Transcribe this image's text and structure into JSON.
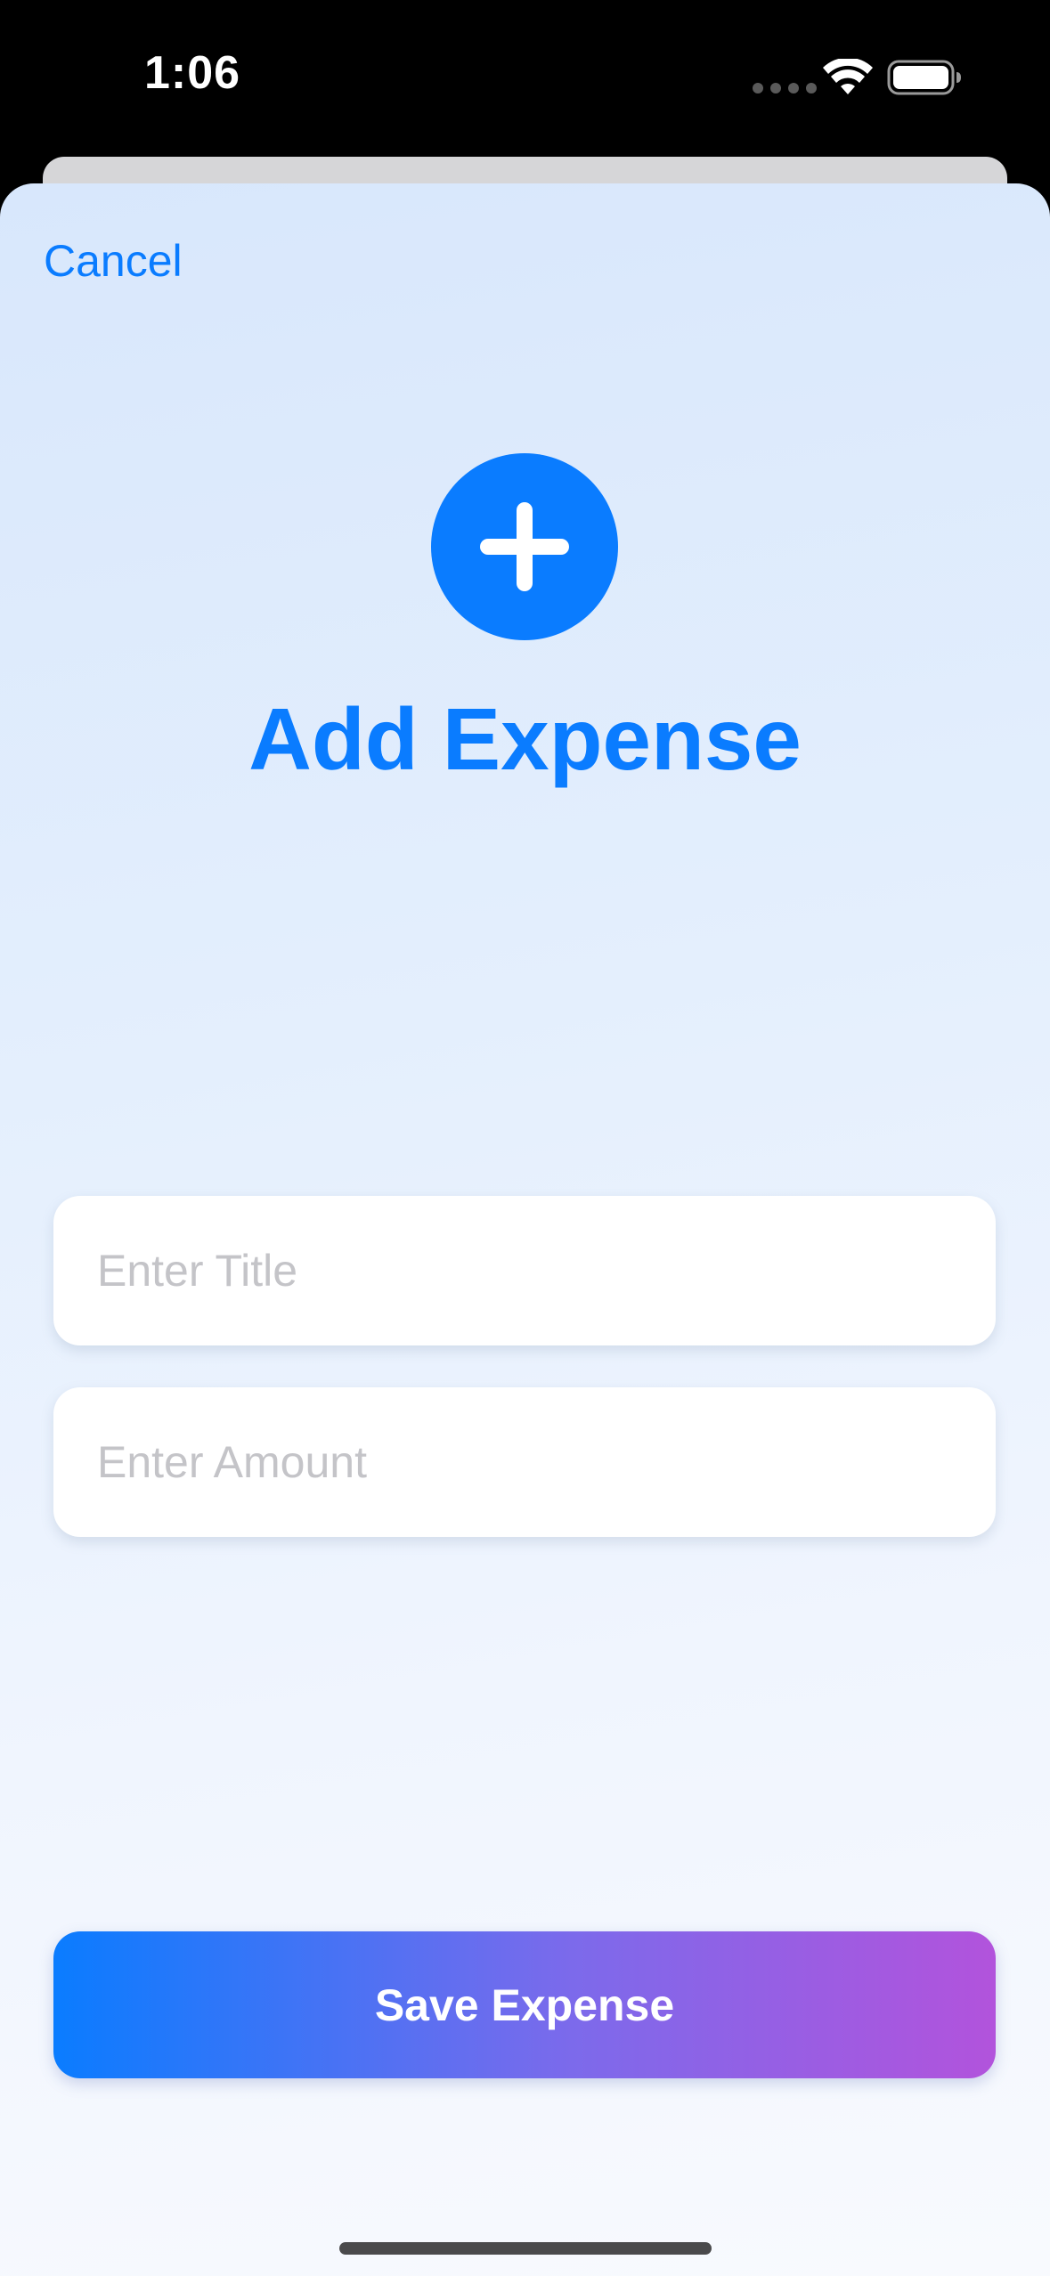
{
  "status_bar": {
    "time": "1:06",
    "icons": [
      "signal-dots-icon",
      "wifi-icon",
      "battery-icon"
    ]
  },
  "sheet": {
    "cancel_label": "Cancel",
    "header_icon": "plus-circle-icon",
    "title": "Add Expense",
    "title_field": {
      "placeholder": "Enter Title",
      "value": ""
    },
    "amount_field": {
      "placeholder": "Enter Amount",
      "value": ""
    },
    "save_label": "Save Expense"
  },
  "colors": {
    "accent": "#0a7cff",
    "button_gradient_start": "#0a7cff",
    "button_gradient_end": "#b253dc",
    "placeholder": "#c4c4c8"
  }
}
